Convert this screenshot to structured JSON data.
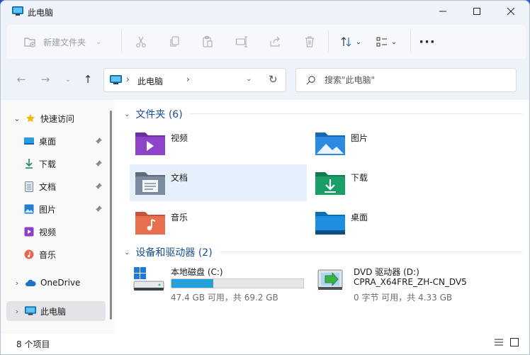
{
  "window": {
    "title": "此电脑"
  },
  "toolbar": {
    "new_label": "新建文件夹",
    "more_label": "···"
  },
  "address": {
    "location": "此电脑"
  },
  "search": {
    "placeholder": "搜索\"此电脑\""
  },
  "sidebar": {
    "items": [
      {
        "label": "快速访问",
        "icon": "star-icon",
        "expandable": true
      },
      {
        "label": "桌面",
        "icon": "desktop-folder-icon",
        "pinned": true
      },
      {
        "label": "下载",
        "icon": "download-arrow-icon",
        "pinned": true
      },
      {
        "label": "文档",
        "icon": "document-icon",
        "pinned": true
      },
      {
        "label": "图片",
        "icon": "picture-icon",
        "pinned": true
      },
      {
        "label": "视频",
        "icon": "video-icon"
      },
      {
        "label": "音乐",
        "icon": "music-icon"
      },
      {
        "label": "OneDrive",
        "icon": "cloud-icon",
        "expandable": true
      },
      {
        "label": "此电脑",
        "icon": "computer-icon",
        "expandable": true,
        "active": true
      }
    ]
  },
  "folders": {
    "header": "文件夹 (6)",
    "items": [
      {
        "name": "视频",
        "icon": "video-folder-icon"
      },
      {
        "name": "图片",
        "icon": "pictures-folder-icon"
      },
      {
        "name": "文档",
        "icon": "documents-folder-icon",
        "selected": true
      },
      {
        "name": "下载",
        "icon": "downloads-folder-icon"
      },
      {
        "name": "音乐",
        "icon": "music-folder-icon"
      },
      {
        "name": "桌面",
        "icon": "desktop-folder-icon"
      }
    ]
  },
  "devices": {
    "header": "设备和驱动器 (2)",
    "items": [
      {
        "name": "本地磁盘 (C:)",
        "free_text": "47.4 GB 可用，共 69.2 GB",
        "used_fraction": 0.315,
        "icon": "hard-drive-icon"
      },
      {
        "name": "DVD 驱动器 (D:)",
        "volume": "CPRA_X64FRE_ZH-CN_DV5",
        "free_text": "0 字节 可用，共 4.33 GB",
        "icon": "dvd-drive-icon"
      }
    ]
  },
  "status": {
    "item_count": "8 个项目"
  },
  "colors": {
    "accent": "#26a0da",
    "selection": "#e5f0fb",
    "header_text": "#1a4d8f"
  }
}
